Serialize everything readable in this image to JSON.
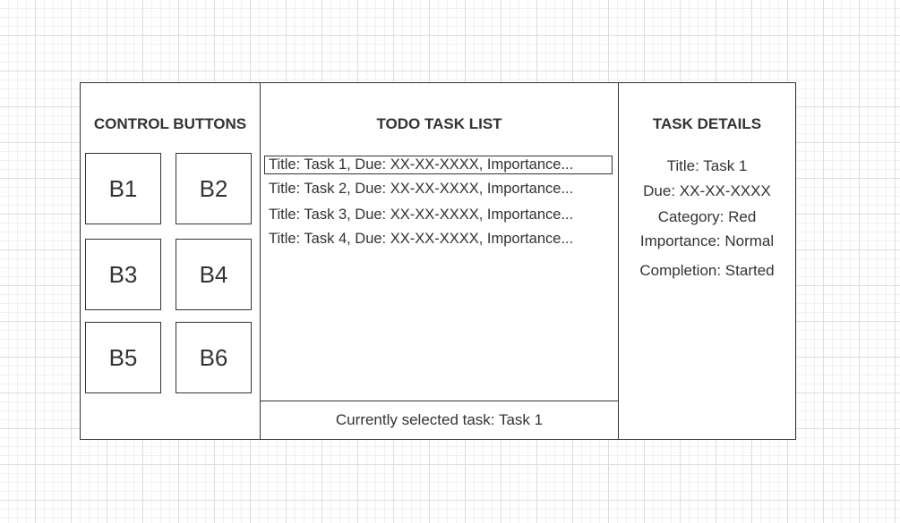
{
  "control_panel": {
    "heading": "CONTROL BUTTONS",
    "buttons": [
      "B1",
      "B2",
      "B3",
      "B4",
      "B5",
      "B6"
    ]
  },
  "task_panel": {
    "heading": "TODO TASK LIST",
    "tasks": [
      "Title: Task 1, Due: XX-XX-XXXX, Importance...",
      "Title: Task 2, Due: XX-XX-XXXX, Importance...",
      "Title: Task 3, Due: XX-XX-XXXX, Importance...",
      "Title: Task 4, Due: XX-XX-XXXX, Importance..."
    ],
    "selected_index": 0,
    "status_text": "Currently selected task: Task 1"
  },
  "details_panel": {
    "heading": "TASK DETAILS",
    "title": "Title: Task 1",
    "due": "Due: XX-XX-XXXX",
    "category": "Category: Red",
    "importance": "Importance: Normal",
    "completion": "Completion: Started"
  },
  "colors": {
    "stroke": "#333333",
    "text": "#333333",
    "background": "#ffffff",
    "grid": "#dddddd"
  }
}
